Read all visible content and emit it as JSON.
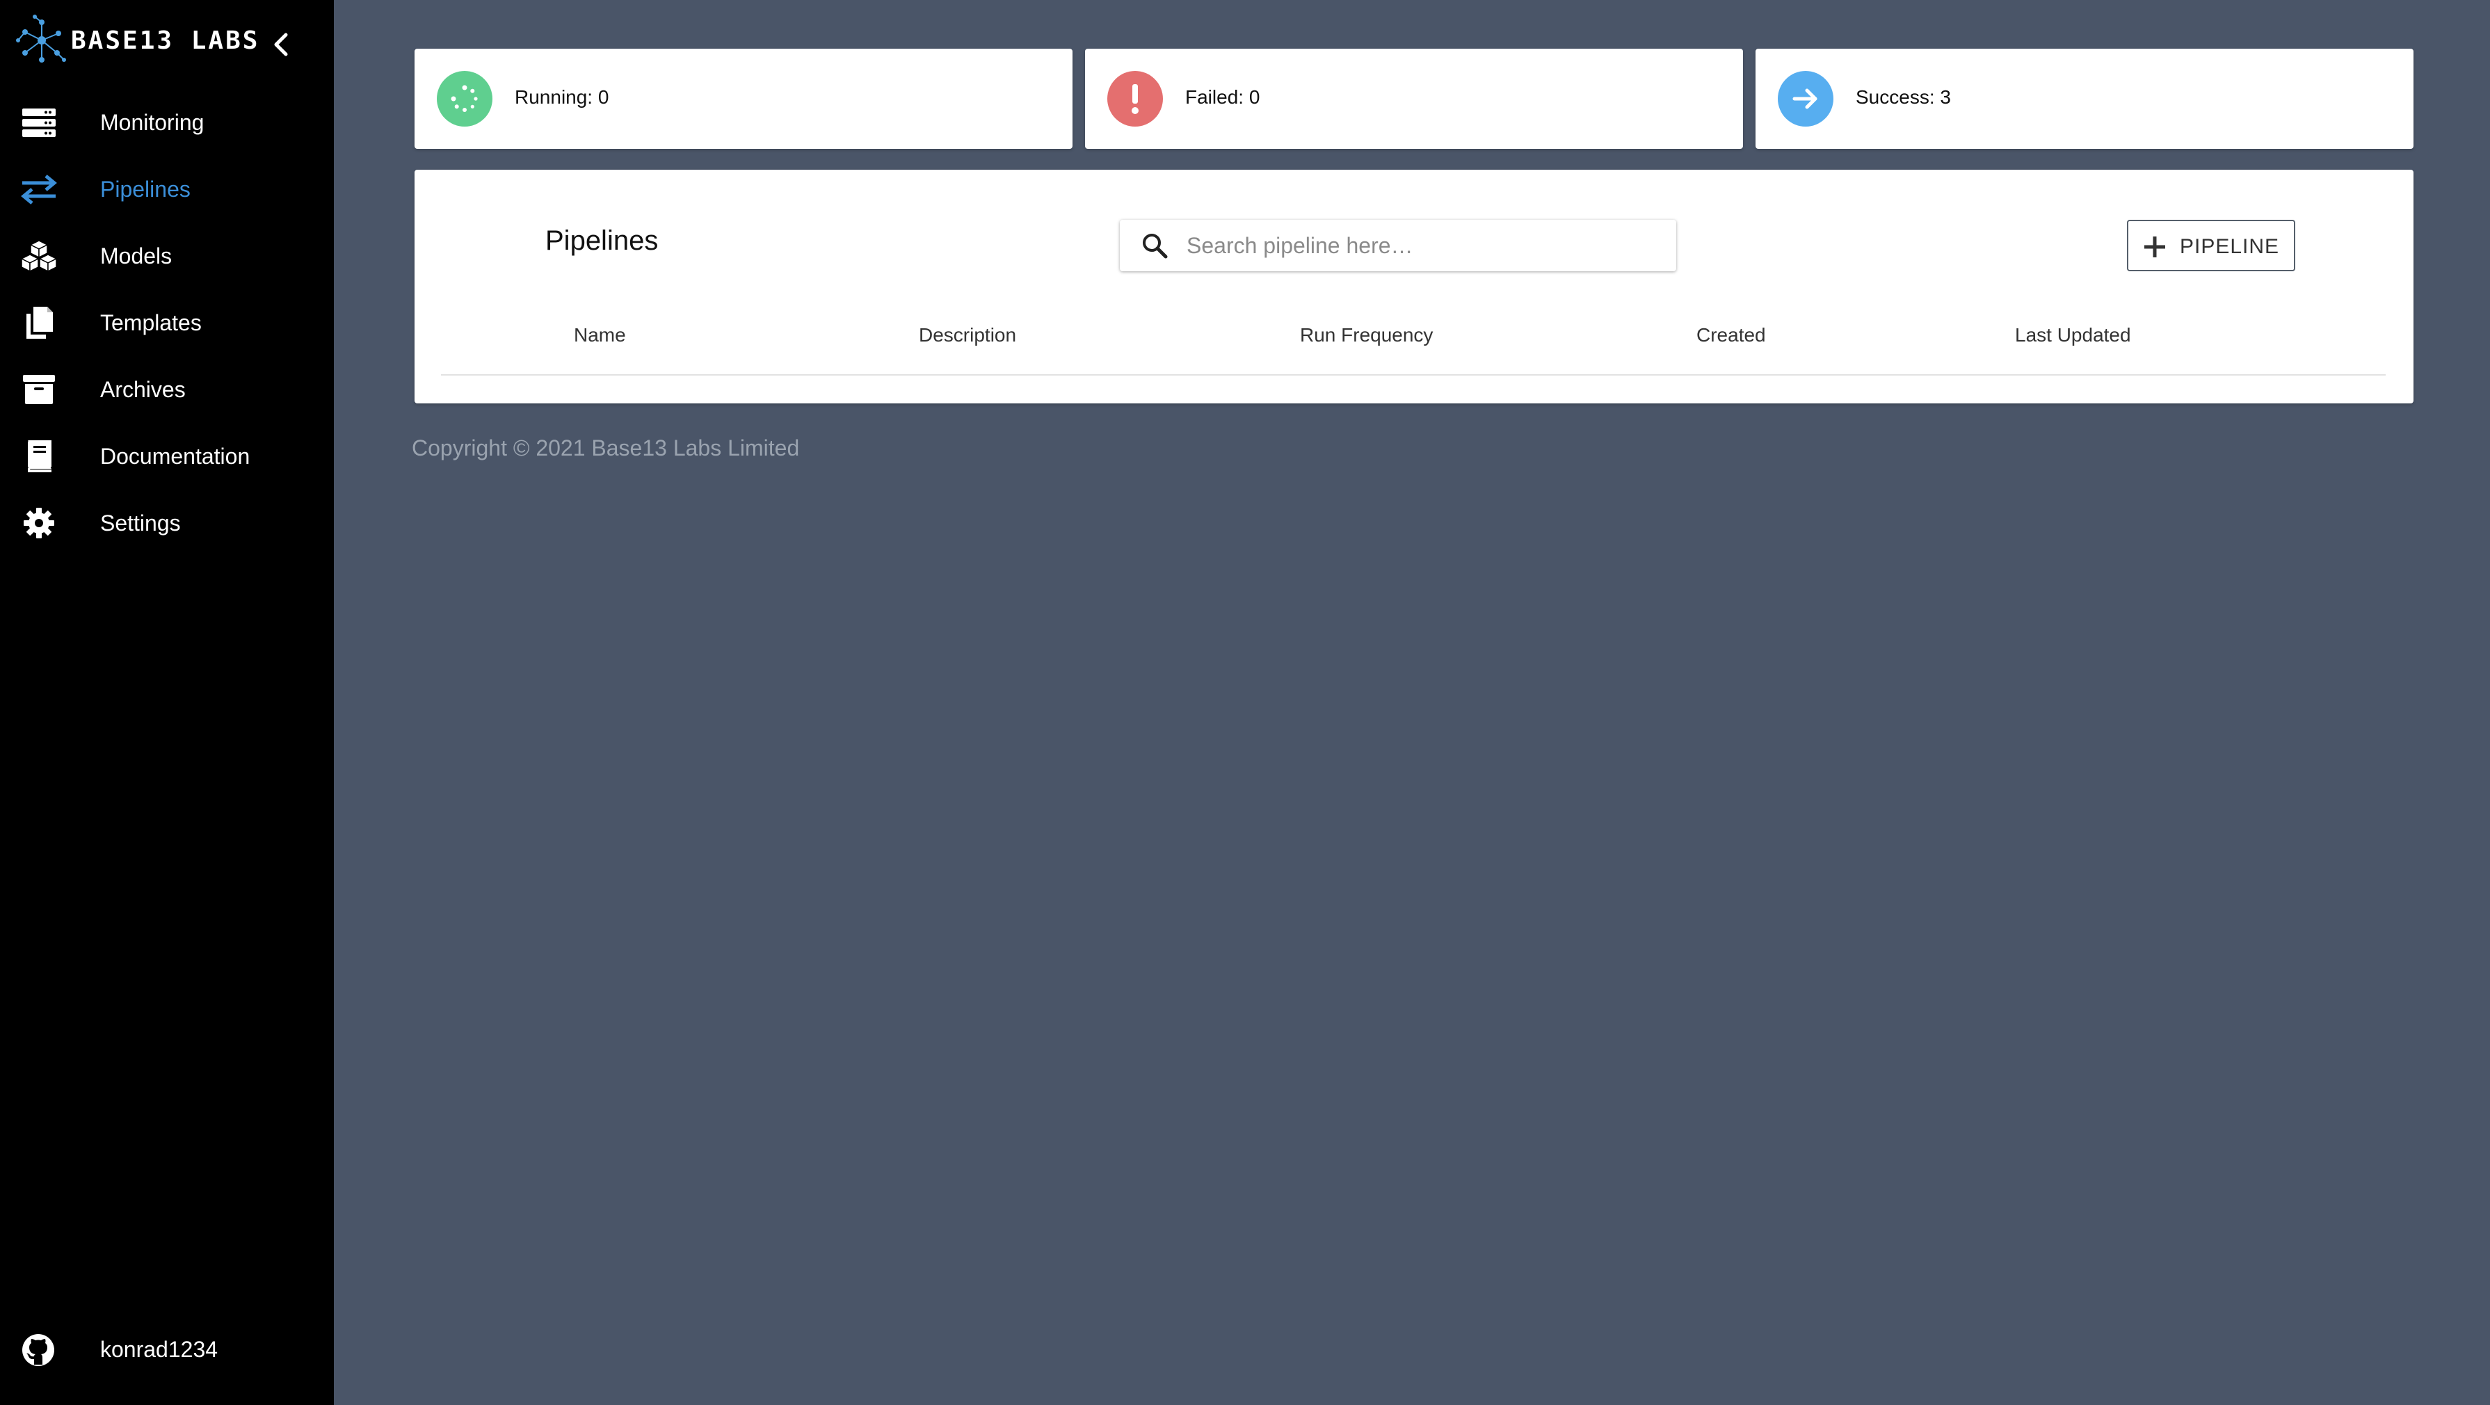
{
  "sidebar": {
    "brand": "BASE13 LABS",
    "items": [
      {
        "label": "Monitoring",
        "icon": "server-icon"
      },
      {
        "label": "Pipelines",
        "icon": "swap-arrows-icon",
        "active": true
      },
      {
        "label": "Models",
        "icon": "cubes-icon"
      },
      {
        "label": "Templates",
        "icon": "copy-icon"
      },
      {
        "label": "Archives",
        "icon": "archive-icon"
      },
      {
        "label": "Documentation",
        "icon": "book-icon"
      },
      {
        "label": "Settings",
        "icon": "gear-icon"
      }
    ],
    "user": {
      "label": "konrad1234",
      "icon": "github-icon"
    }
  },
  "stats": {
    "running": {
      "label": "Running: 0",
      "color": "#5fcf8f"
    },
    "failed": {
      "label": "Failed: 0",
      "color": "#e46f6f"
    },
    "success": {
      "label": "Success: 3",
      "color": "#57aef0"
    }
  },
  "pipelines": {
    "title": "Pipelines",
    "search_placeholder": "Search pipeline here…",
    "add_button_label": "PIPELINE",
    "columns": [
      "Name",
      "Description",
      "Run Frequency",
      "Created",
      "Last Updated"
    ],
    "rows": []
  },
  "footer": {
    "copyright": "Copyright © 2021 Base13 Labs Limited"
  },
  "colors": {
    "sidebar_bg": "#000000",
    "main_bg": "#4a5568",
    "accent": "#3b8fd9"
  }
}
